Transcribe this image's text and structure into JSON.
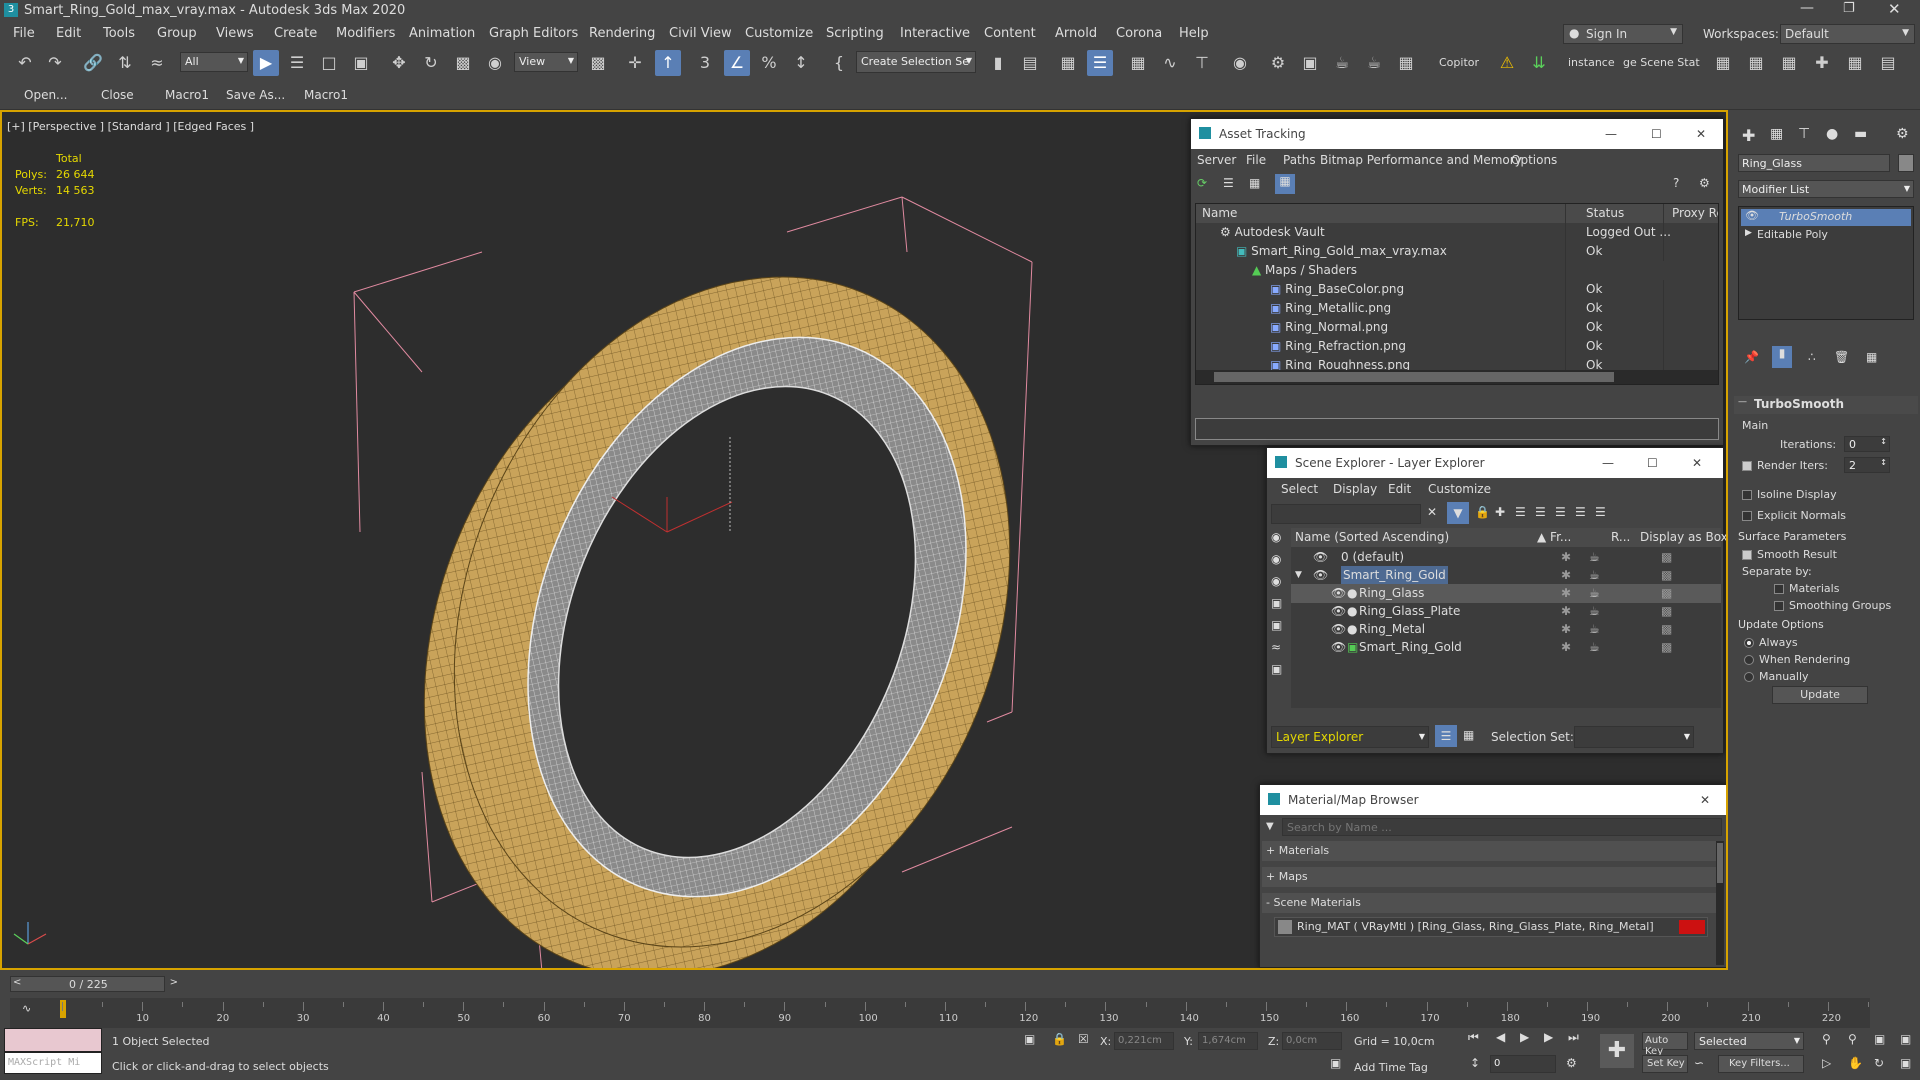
{
  "app": {
    "title": "Smart_Ring_Gold_max_vray.max - Autodesk 3ds Max 2020"
  },
  "menu": [
    "File",
    "Edit",
    "Tools",
    "Group",
    "Views",
    "Create",
    "Modifiers",
    "Animation",
    "Graph Editors",
    "Rendering",
    "Civil View",
    "Customize",
    "Scripting",
    "Interactive",
    "Content",
    "Arnold",
    "Corona",
    "Help"
  ],
  "account": {
    "sign_in": "Sign In",
    "workspaces_label": "Workspaces:",
    "workspace": "Default"
  },
  "toolbar": {
    "filter": "All",
    "view": "View",
    "selection_set": "Create Selection Se",
    "copitor": "Copitor",
    "instance": "instance",
    "scene_stat": "ge Scene Stat"
  },
  "macros": [
    "Open...",
    "Close",
    "Macro1",
    "Save As...",
    "Macro1"
  ],
  "viewport": {
    "label": "[+] [Perspective ] [Standard ] [Edged Faces ]",
    "stats": {
      "total": "Total",
      "polys_label": "Polys:",
      "polys": "26 644",
      "verts_label": "Verts:",
      "verts": "14 563",
      "fps_label": "FPS:",
      "fps": "21,710"
    }
  },
  "asset_tracking": {
    "title": "Asset Tracking",
    "menu": [
      "Server",
      "File",
      "Paths",
      "Bitmap Performance and Memory",
      "Options"
    ],
    "columns": [
      "Name",
      "Status",
      "Proxy Res"
    ],
    "rows": [
      {
        "name": "Autodesk Vault",
        "status": "Logged Out ..."
      },
      {
        "name": "Smart_Ring_Gold_max_vray.max",
        "status": "Ok"
      },
      {
        "name": "Maps / Shaders",
        "status": ""
      },
      {
        "name": "Ring_BaseColor.png",
        "status": "Ok"
      },
      {
        "name": "Ring_Metallic.png",
        "status": "Ok"
      },
      {
        "name": "Ring_Normal.png",
        "status": "Ok"
      },
      {
        "name": "Ring_Refraction.png",
        "status": "Ok"
      },
      {
        "name": "Ring_Roughness.png",
        "status": "Ok"
      }
    ]
  },
  "scene_explorer": {
    "title": "Scene Explorer - Layer Explorer",
    "menu": [
      "Select",
      "Display",
      "Edit",
      "Customize"
    ],
    "columns": [
      "Name (Sorted Ascending)",
      "▲ Fr...",
      "R...",
      "Display as Box"
    ],
    "rows": [
      "0 (default)",
      "Smart_Ring_Gold",
      "Ring_Glass",
      "Ring_Glass_Plate",
      "Ring_Metal",
      "Smart_Ring_Gold"
    ],
    "footer_explorer": "Layer Explorer",
    "selection_set_label": "Selection Set:"
  },
  "material_browser": {
    "title": "Material/Map Browser",
    "search_placeholder": "Search by Name ...",
    "sections": [
      "+ Materials",
      "+ Maps",
      "- Scene Materials"
    ],
    "material": "Ring_MAT  ( VRayMtl )  [Ring_Glass, Ring_Glass_Plate, Ring_Metal]"
  },
  "modify_panel": {
    "object_name": "Ring_Glass",
    "modifier_list": "Modifier List",
    "stack": [
      "TurboSmooth",
      "Editable Poly"
    ],
    "rollout_title": "TurboSmooth",
    "main_label": "Main",
    "iterations_label": "Iterations:",
    "iterations": "0",
    "render_iters_label": "Render Iters:",
    "render_iters": "2",
    "isoline": "Isoline Display",
    "explicit_normals": "Explicit Normals",
    "surface_params": "Surface Parameters",
    "smooth_result": "Smooth Result",
    "separate_by": "Separate by:",
    "materials": "Materials",
    "smoothing_groups": "Smoothing Groups",
    "update_options": "Update Options",
    "always": "Always",
    "when_rendering": "When Rendering",
    "manually": "Manually",
    "update_button": "Update"
  },
  "timeline": {
    "frame": "0 / 225",
    "ticks": [
      "10",
      "20",
      "30",
      "40",
      "50",
      "60",
      "70",
      "80",
      "90",
      "100",
      "110",
      "120",
      "130",
      "140",
      "150",
      "160",
      "170",
      "180",
      "190",
      "200",
      "210",
      "220"
    ]
  },
  "status": {
    "maxscript": "MAXScript Mi",
    "selected": "1 Object Selected",
    "hint": "Click or click-and-drag to select objects",
    "x_label": "X:",
    "x": "0,221cm",
    "y_label": "Y:",
    "y": "1,674cm",
    "z_label": "Z:",
    "z": "0,0cm",
    "grid": "Grid = 10,0cm",
    "add_time_tag": "Add Time Tag",
    "auto_key": "Auto Key",
    "set_key": "Set Key",
    "selected_dd": "Selected",
    "key_filters": "Key Filters...",
    "frame_field": "0"
  },
  "colors": {
    "accent": "#5a7fb5",
    "viewport_border": "#d7a300",
    "ring_gold": "#c9a35a",
    "material_swatch": "#cc1111"
  }
}
